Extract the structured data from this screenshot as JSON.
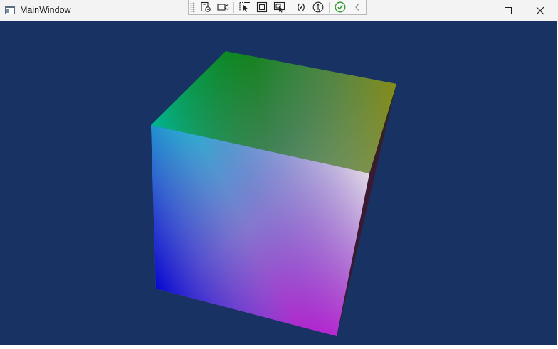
{
  "window": {
    "title": "MainWindow",
    "background_color": "#193264",
    "caption_buttons": [
      {
        "name": "minimize-button",
        "icon": "minimize-icon"
      },
      {
        "name": "maximize-button",
        "icon": "maximize-icon"
      },
      {
        "name": "close-button",
        "icon": "close-icon"
      }
    ]
  },
  "debug_toolbar": {
    "buttons": [
      {
        "name": "live-visual-tree-button",
        "icon": "visual-tree-icon"
      },
      {
        "name": "record-button",
        "icon": "camera-icon"
      },
      {
        "name": "select-element-button",
        "icon": "select-element-icon"
      },
      {
        "name": "display-layout-adorners-button",
        "icon": "layout-adorner-icon"
      },
      {
        "name": "track-focus-button",
        "icon": "track-focus-icon"
      },
      {
        "name": "binding-failures-button",
        "icon": "binding-icon"
      },
      {
        "name": "accessibility-button",
        "icon": "accessibility-icon"
      },
      {
        "name": "hot-reload-status-button",
        "icon": "check-circle-icon"
      },
      {
        "name": "collapse-toolbar-button",
        "icon": "chevron-left-icon"
      }
    ]
  },
  "scene": {
    "object": "rgb-color-cube",
    "face_colors": {
      "green": "#008000",
      "cyan": "#00d2d2",
      "olive": "#8a8a00",
      "white": "#e6e6e6",
      "blue": "#0000d2",
      "magenta": "#d200d2"
    }
  }
}
